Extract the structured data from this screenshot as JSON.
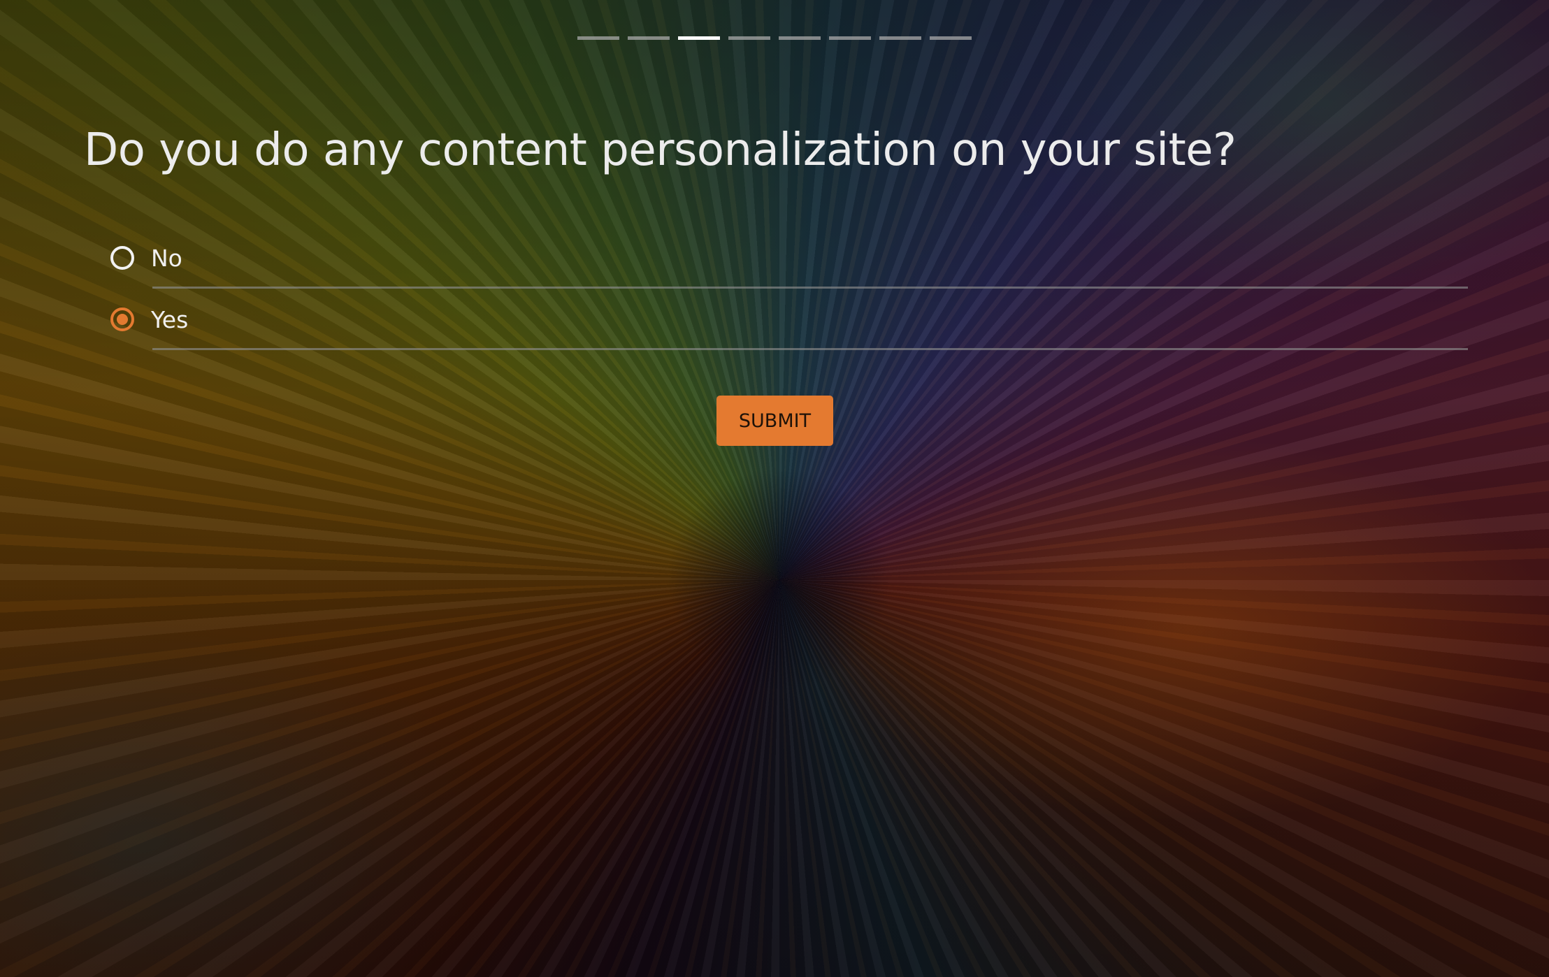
{
  "progress": {
    "total_steps": 8,
    "current_step": 3
  },
  "question": {
    "text": "Do you do any content personalization on your site?"
  },
  "options": [
    {
      "label": "No",
      "selected": false
    },
    {
      "label": "Yes",
      "selected": true
    }
  ],
  "submit": {
    "label": "SUBMIT"
  },
  "colors": {
    "accent": "#e47a30",
    "text": "#ececec",
    "progress_active": "#ffffff",
    "progress_inactive": "#aaaaaa"
  }
}
